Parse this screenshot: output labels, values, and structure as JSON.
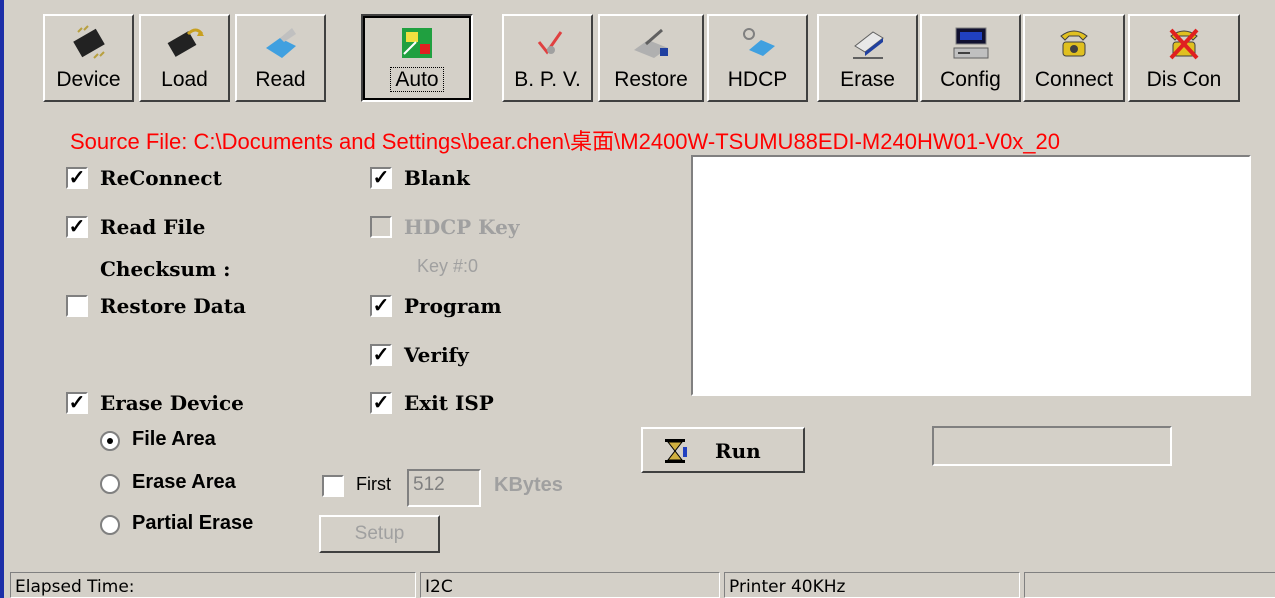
{
  "toolbar": {
    "buttons": [
      {
        "label": "Device",
        "icon": "chip-icon"
      },
      {
        "label": "Load",
        "icon": "load-chip-icon"
      },
      {
        "label": "Read",
        "icon": "read-icon"
      },
      {
        "label": "Auto",
        "icon": "auto-icon"
      },
      {
        "label": "B. P. V.",
        "icon": "bpv-icon"
      },
      {
        "label": "Restore",
        "icon": "restore-icon"
      },
      {
        "label": "HDCP",
        "icon": "hdcp-key-icon"
      },
      {
        "label": "Erase",
        "icon": "eraser-icon"
      },
      {
        "label": "Config",
        "icon": "computer-icon"
      },
      {
        "label": "Connect",
        "icon": "phone-icon"
      },
      {
        "label": "Dis Con",
        "icon": "disconnect-phone-icon"
      }
    ]
  },
  "source_file": "Source File: C:\\Documents and Settings\\bear.chen\\桌面\\M2400W-TSUMU88EDI-M240HW01-V0x_20",
  "options": {
    "reconnect": {
      "label": "ReConnect",
      "checked": true
    },
    "read_file": {
      "label": "Read File",
      "checked": true
    },
    "checksum_label": "Checksum :",
    "restore_data": {
      "label": "Restore Data",
      "checked": false
    },
    "erase_device": {
      "label": "Erase Device",
      "checked": true
    },
    "file_area": "File Area",
    "erase_area": "Erase Area",
    "partial_erase": "Partial Erase",
    "blank": {
      "label": "Blank",
      "checked": true
    },
    "hdcp_key": {
      "label": "HDCP Key",
      "checked": false
    },
    "key_number": "Key #:0",
    "program": {
      "label": "Program",
      "checked": true
    },
    "verify": {
      "label": "Verify",
      "checked": true
    },
    "exit_isp": {
      "label": "Exit ISP",
      "checked": true
    },
    "first": {
      "label": "First",
      "checked": false
    },
    "first_value": "512",
    "kbytes_label": "KBytes",
    "setup_label": "Setup",
    "run_label": "Run",
    "selected_erase_mode": "File Area"
  },
  "status_bar": {
    "elapsed": "Elapsed Time:",
    "interface": "I2C",
    "speed": "Printer  40KHz",
    "extra": ""
  },
  "colors": {
    "source_text": "#ff0000",
    "accent_border": "#1c2fa8",
    "face": "#d4d0c8"
  }
}
